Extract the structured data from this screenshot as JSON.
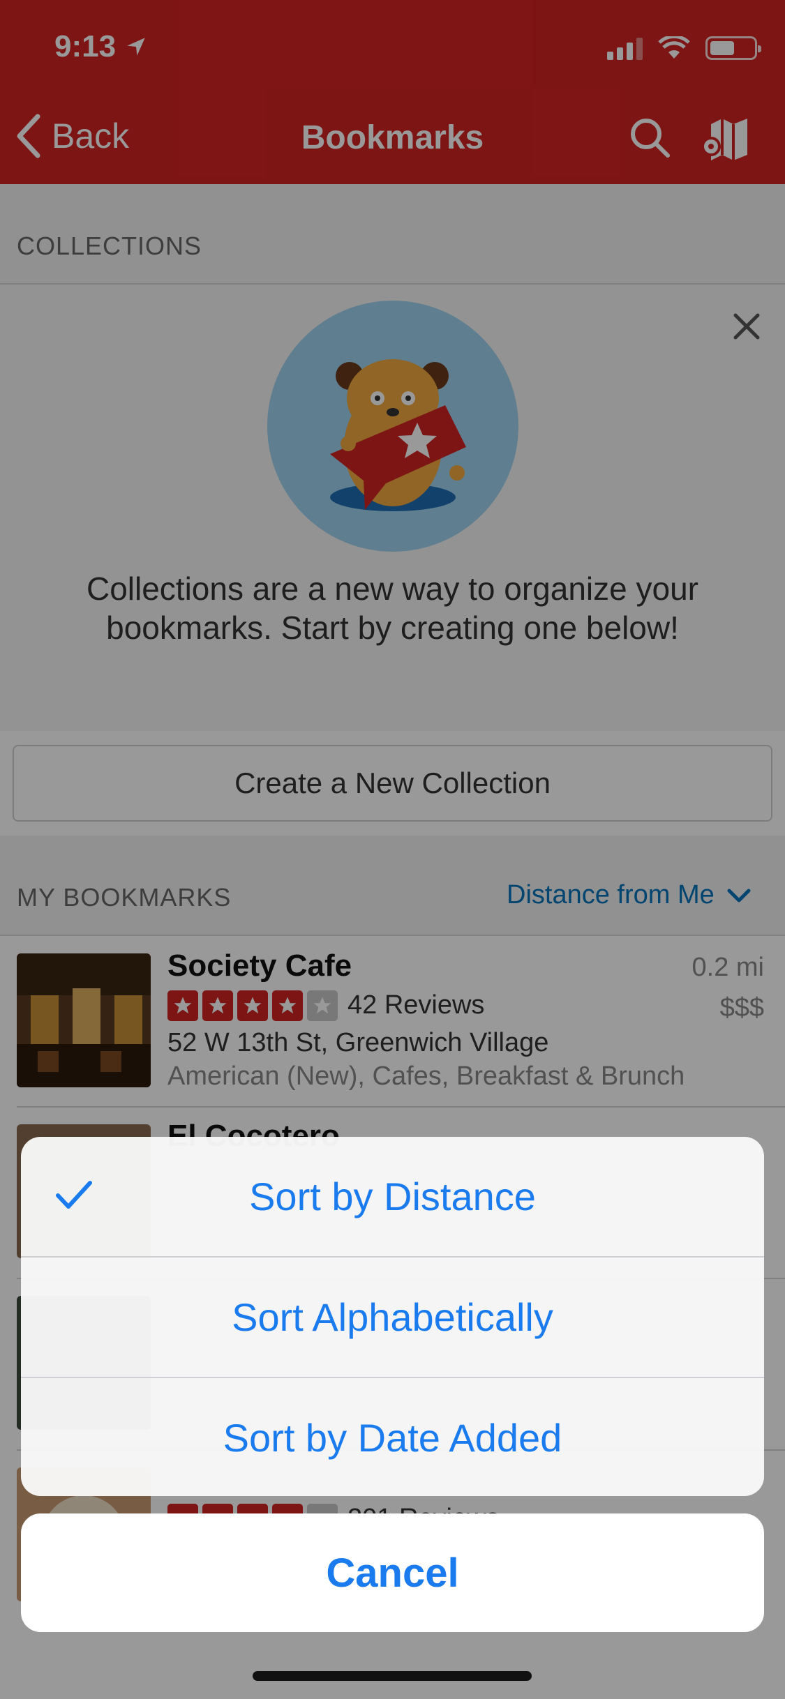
{
  "status_bar": {
    "time": "9:13"
  },
  "nav": {
    "back_label": "Back",
    "title": "Bookmarks"
  },
  "collections": {
    "section_label": "COLLECTIONS",
    "promo_text": "Collections are a new way to organize your bookmarks. Start by creating one below!",
    "create_button_label": "Create a New Collection"
  },
  "bookmarks": {
    "section_label": "MY BOOKMARKS",
    "sort_label": "Distance from Me",
    "items": [
      {
        "name": "Society Cafe",
        "rating": 4,
        "reviews": "42 Reviews",
        "address": "52 W 13th St, Greenwich Village",
        "categories": "American (New), Cafes, Breakfast & Brunch",
        "distance": "0.2 mi",
        "price": "$$$"
      },
      {
        "name": "El Cocotero"
      },
      {
        "name": ""
      },
      {
        "reviews": "201 Reviews"
      }
    ]
  },
  "action_sheet": {
    "options": [
      {
        "label": "Sort by Distance",
        "selected": true
      },
      {
        "label": "Sort Alphabetically",
        "selected": false
      },
      {
        "label": "Sort by Date Added",
        "selected": false
      }
    ],
    "cancel_label": "Cancel"
  },
  "colors": {
    "brand_red": "#d32323",
    "ios_blue": "#1a7bef",
    "link_blue": "#0073bb"
  }
}
